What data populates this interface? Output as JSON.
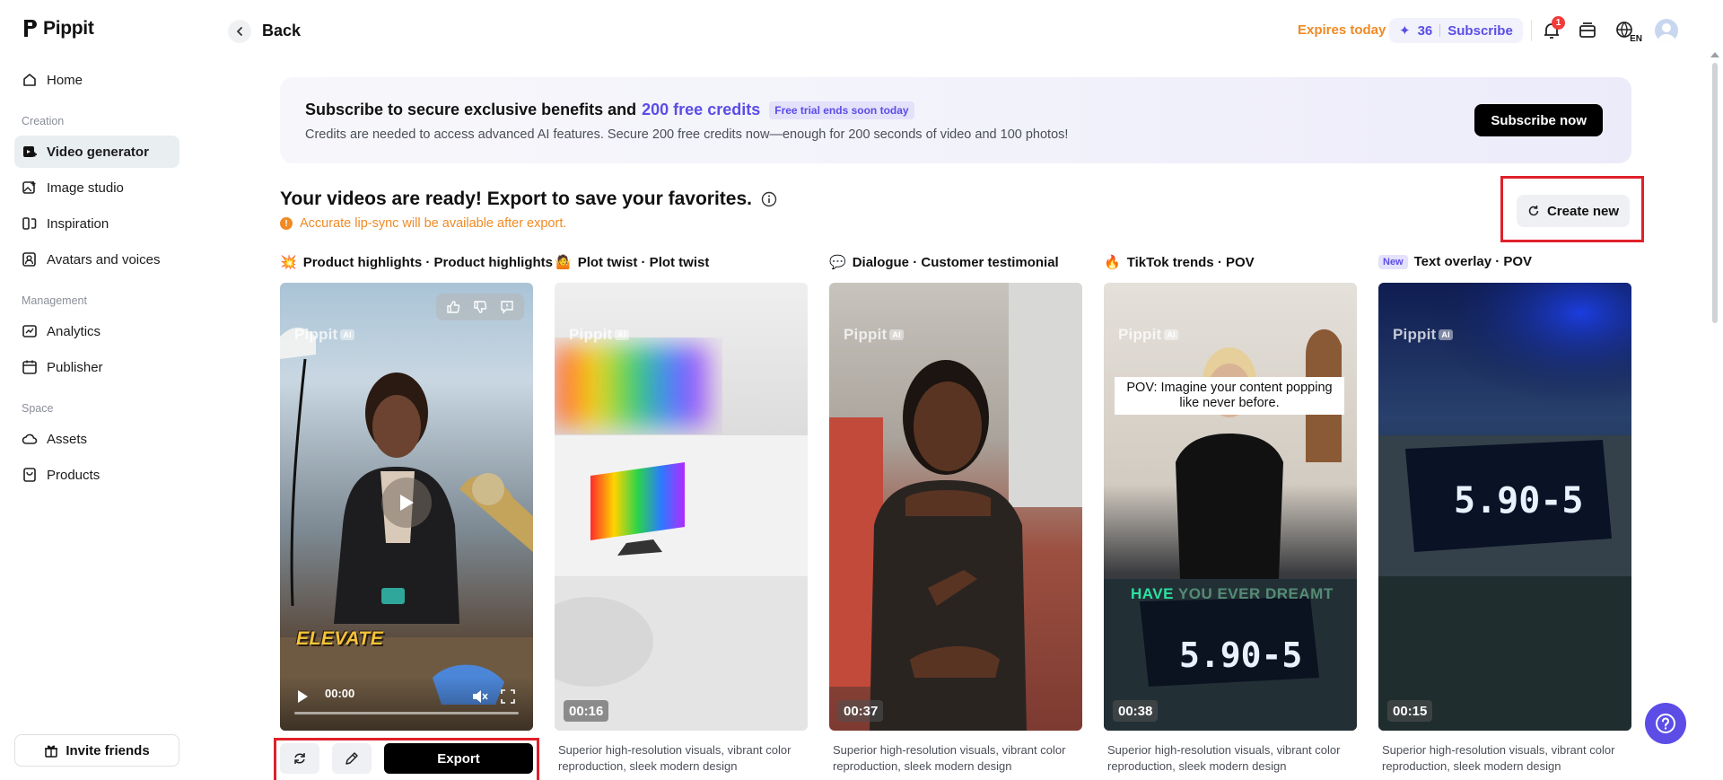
{
  "app": {
    "name": "Pippit"
  },
  "sidebar": {
    "home": "Home",
    "sections": {
      "creation": "Creation",
      "management": "Management",
      "space": "Space"
    },
    "items": {
      "video_generator": "Video generator",
      "image_studio": "Image studio",
      "inspiration": "Inspiration",
      "avatars_voices": "Avatars and voices",
      "analytics": "Analytics",
      "publisher": "Publisher",
      "assets": "Assets",
      "products": "Products"
    },
    "active_item": "Video generator",
    "invite": "Invite friends"
  },
  "topbar": {
    "back": "Back",
    "expires": "Expires today",
    "credits": "36",
    "subscribe": "Subscribe",
    "notification_count": "1",
    "language": "EN"
  },
  "banner": {
    "title_prefix": "Subscribe to secure exclusive benefits and",
    "title_highlight": "200 free credits",
    "trial_tag": "Free trial ends soon today",
    "subtitle": "Credits are needed to access advanced AI features. Secure 200 free credits now—enough for 200 seconds of video and 100 photos!",
    "cta": "Subscribe now"
  },
  "main": {
    "heading": "Your videos are ready! Export to save your favorites.",
    "warning": "Accurate lip-sync will be available after export.",
    "create_new": "Create new"
  },
  "watermark": {
    "brand": "Pippit",
    "badge": "AI"
  },
  "cards": [
    {
      "emoji": "💥",
      "title": "Product highlights · Product highlights",
      "duration": "00:00",
      "overlay_text": "ELEVATE",
      "description": ""
    },
    {
      "emoji": "🤷",
      "title": "Plot twist · Plot twist",
      "duration": "00:16",
      "description": "Superior high-resolution visuals, vibrant color reproduction, sleek modern design"
    },
    {
      "emoji": "💬",
      "title": "Dialogue · Customer testimonial",
      "duration": "00:37",
      "description": "Superior high-resolution visuals, vibrant color reproduction, sleek modern design"
    },
    {
      "emoji": "🔥",
      "title": "TikTok trends · POV",
      "duration": "00:38",
      "caption": "POV: Imagine your content popping like never before.",
      "overlay_bright": "HAVE",
      "overlay_dim": "YOU EVER DREAMT",
      "timer": "5.90-5",
      "description": "Superior high-resolution visuals, vibrant color reproduction, sleek modern design"
    },
    {
      "tag": "New",
      "title": "Text overlay · POV",
      "duration": "00:15",
      "timer": "5.90-5",
      "description": "Superior high-resolution visuals, vibrant color reproduction, sleek modern design"
    }
  ],
  "card_actions": {
    "export": "Export"
  },
  "colors": {
    "accent": "#5b4de6",
    "warning": "#f08a24",
    "highlight_frame": "#e0202b"
  }
}
